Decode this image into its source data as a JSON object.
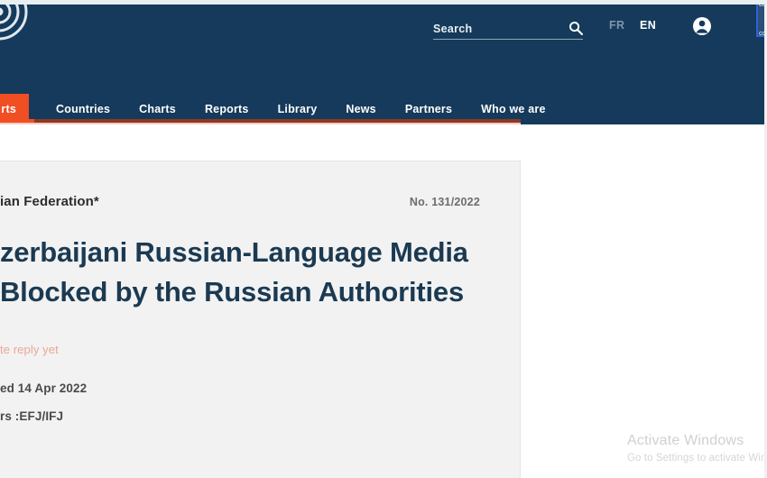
{
  "header": {
    "background_color": "#153a5b",
    "logo_name": "council-of-europe-platform-logo",
    "search": {
      "placeholder": "Search",
      "value": "",
      "icon": "search-icon"
    },
    "languages": [
      {
        "code": "FR",
        "active": false
      },
      {
        "code": "EN",
        "active": true
      }
    ],
    "account_icon": "user-account-icon",
    "edge_widget": {
      "top_text": "CO",
      "bottom_text": "CO"
    }
  },
  "nav": {
    "accent_color": "#f04e23",
    "items": [
      {
        "label": "rts",
        "active": true
      },
      {
        "label": "Countries",
        "active": false
      },
      {
        "label": "Charts",
        "active": false
      },
      {
        "label": "Reports",
        "active": false
      },
      {
        "label": "Library",
        "active": false
      },
      {
        "label": "News",
        "active": false
      },
      {
        "label": "Partners",
        "active": false
      },
      {
        "label": "Who we are",
        "active": false
      }
    ]
  },
  "alert": {
    "country": "ian Federation*",
    "number": "No. 131/2022",
    "title": "zerbaijani Russian-Language Media Blocked by the Russian Authorities",
    "reply_status": "te reply yet",
    "reply_status_color": "#eaa793",
    "published": "ed 14 Apr 2022",
    "partners": "rs :EFJ/IFJ"
  },
  "watermark": {
    "title": "Activate Windows",
    "subtitle": "Go to Settings to activate Windows."
  }
}
